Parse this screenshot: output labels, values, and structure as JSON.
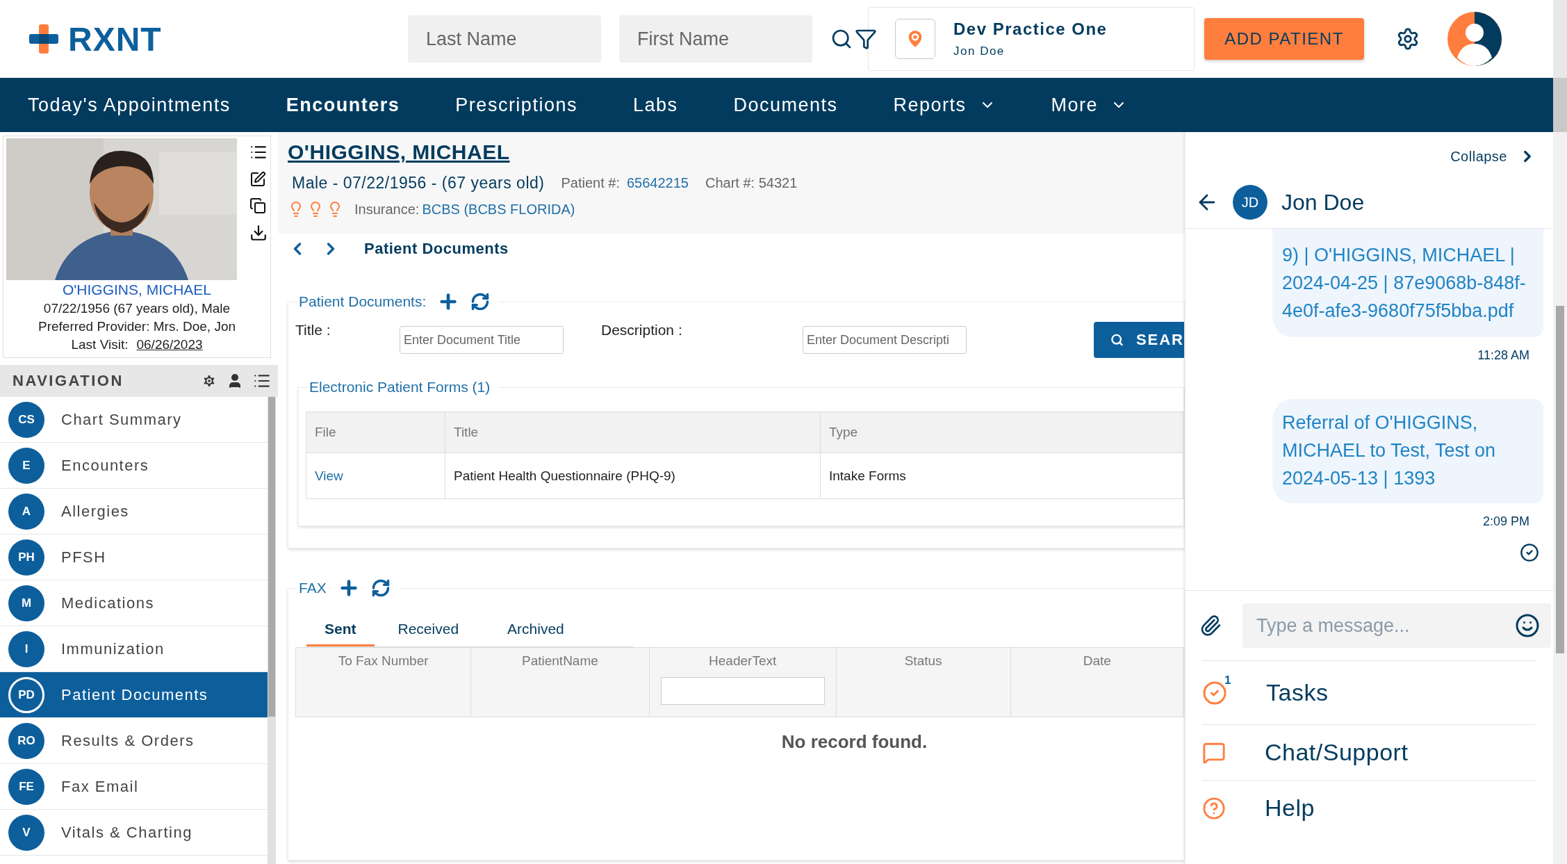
{
  "header": {
    "logo": "RXNT",
    "search_fields": [
      {
        "placeholder": "Last Name"
      },
      {
        "placeholder": "First Name"
      }
    ],
    "practice": {
      "name": "Dev Practice One",
      "user": "Jon Doe"
    },
    "add_button": "ADD PATIENT"
  },
  "menu": [
    {
      "label": "Today's Appointments",
      "selected": false,
      "dropdown": false
    },
    {
      "label": "Encounters",
      "selected": true,
      "dropdown": false
    },
    {
      "label": "Prescriptions",
      "selected": false,
      "dropdown": false
    },
    {
      "label": "Labs",
      "selected": false,
      "dropdown": false
    },
    {
      "label": "Documents",
      "selected": false,
      "dropdown": false
    },
    {
      "label": "Reports",
      "selected": false,
      "dropdown": true
    },
    {
      "label": "More",
      "selected": false,
      "dropdown": true
    }
  ],
  "patient_card": {
    "name": "O'HIGGINS, MICHAEL",
    "details": "07/22/1956 (67 years old), Male",
    "provider": "Preferred Provider: Mrs. Doe, Jon",
    "last_visit_label": "Last Visit:",
    "last_visit_date": "06/26/2023"
  },
  "navigation": {
    "title": "NAVIGATION",
    "items": [
      {
        "abbr": "CS",
        "label": "Chart Summary",
        "selected": false
      },
      {
        "abbr": "E",
        "label": "Encounters",
        "selected": false
      },
      {
        "abbr": "A",
        "label": "Allergies",
        "selected": false
      },
      {
        "abbr": "PH",
        "label": "PFSH",
        "selected": false
      },
      {
        "abbr": "M",
        "label": "Medications",
        "selected": false
      },
      {
        "abbr": "I",
        "label": "Immunization",
        "selected": false
      },
      {
        "abbr": "PD",
        "label": "Patient Documents",
        "selected": true
      },
      {
        "abbr": "RO",
        "label": "Results & Orders",
        "selected": false
      },
      {
        "abbr": "FE",
        "label": "Fax Email",
        "selected": false
      },
      {
        "abbr": "V",
        "label": "Vitals & Charting",
        "selected": false
      }
    ]
  },
  "patient_header": {
    "name": "O'HIGGINS, MICHAEL",
    "demographics": "Male - 07/22/1956 - (67 years old)",
    "patient_label": "Patient #:",
    "patient_number": "65642215",
    "chart": "Chart #: 54321",
    "insurance_label": "Insurance:",
    "insurance": "BCBS (BCBS FLORIDA)"
  },
  "breadcrumb": "Patient Documents",
  "documents": {
    "legend": "Patient Documents:",
    "filters": [
      {
        "label": "Title :",
        "placeholder": "Enter Document Title"
      },
      {
        "label": "Description :",
        "placeholder": "Enter Document Descripti"
      }
    ],
    "search_button": "SEAR",
    "forms": {
      "legend": "Electronic Patient Forms (1)",
      "columns": [
        "File",
        "Title",
        "Type"
      ],
      "rows": [
        [
          "View",
          "Patient Health Questionnaire (PHQ-9)",
          "Intake Forms"
        ]
      ]
    }
  },
  "fax": {
    "legend": "FAX",
    "tabs": [
      {
        "label": "Sent",
        "selected": true
      },
      {
        "label": "Received",
        "selected": false
      },
      {
        "label": "Archived",
        "selected": false
      }
    ],
    "columns": [
      "To Fax Number",
      "PatientName",
      "HeaderText",
      "Status",
      "Date"
    ],
    "empty": "No record found."
  },
  "chat": {
    "collapse": "Collapse",
    "contact": {
      "initials": "JD",
      "name": "Jon Doe"
    },
    "messages": [
      {
        "text": "9) | O'HIGGINS, MICHAEL | 2024-04-25 | 87e9068b-848f-4e0f-afe3-9680f75f5bba.pdf",
        "time": "11:28 AM"
      },
      {
        "text": "Referral of O'HIGGINS, MICHAEL to Test, Test on 2024-05-13 | 1393",
        "time": "2:09 PM"
      }
    ],
    "input": {
      "placeholder": "Type a message..."
    },
    "links": [
      {
        "kind": "tasks",
        "label": "Tasks",
        "badge": "1"
      },
      {
        "kind": "chat",
        "label": "Chat/Support"
      },
      {
        "kind": "help",
        "label": "Help"
      }
    ]
  }
}
